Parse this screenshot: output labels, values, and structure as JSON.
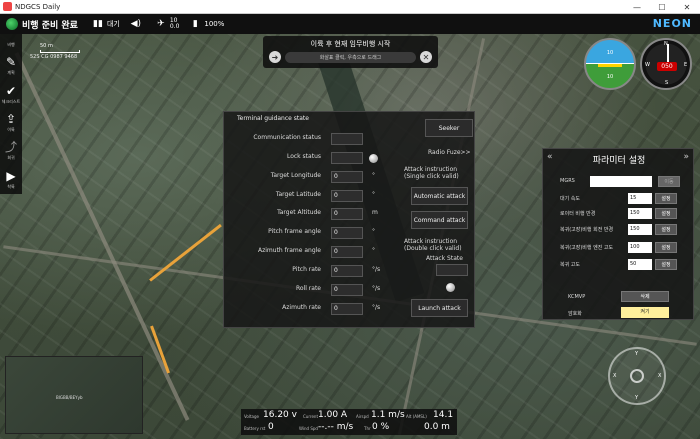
{
  "window": {
    "title": "NDGCS Daily",
    "min": "—",
    "max": "☐",
    "close": "✕"
  },
  "status": {
    "state": "비행 준비 완료",
    "mode_label": "대기",
    "speaker_icon": "speaker-icon",
    "signal_top": "10",
    "signal_bottom": "0.0",
    "battery": "100%"
  },
  "brand": "NEON",
  "toolbar": {
    "items": [
      {
        "label": "비행",
        "icon": "play-icon"
      },
      {
        "label": "계획",
        "icon": "pen-icon"
      },
      {
        "label": "체크리스트",
        "icon": "check-icon"
      },
      {
        "label": "이륙",
        "icon": "takeoff-icon"
      },
      {
        "label": "회귀",
        "icon": "return-icon"
      },
      {
        "label": "착륙",
        "icon": "land-icon"
      }
    ]
  },
  "map": {
    "scale_label": "50 m",
    "coord": "52S CG 0987 9468",
    "minimap_label": "BIGBB/BEYyb"
  },
  "mission": {
    "title": "이륙 후 현재 임무비행 시작",
    "slider_text": "화살표 클릭, 우측으로 드래그",
    "left_icon": "arrow-right-icon",
    "right_icon": "close-icon"
  },
  "attitude": {
    "top": "10",
    "mid": "10"
  },
  "compass": {
    "heading": "050",
    "n": "N",
    "e": "E",
    "s": "S",
    "w": "W"
  },
  "guidance": {
    "title": "Terminal guidance state",
    "rows": [
      {
        "label": "Communication status",
        "value": "",
        "unit": ""
      },
      {
        "label": "Lock status",
        "value": "",
        "unit": ""
      },
      {
        "label": "Target Longitude",
        "value": "0",
        "unit": "°"
      },
      {
        "label": "Target Latitude",
        "value": "0",
        "unit": "°"
      },
      {
        "label": "Target Altitude",
        "value": "0",
        "unit": "m"
      },
      {
        "label": "Pitch frame angle",
        "value": "0",
        "unit": "°"
      },
      {
        "label": "Azimuth frame angle",
        "value": "0",
        "unit": "°"
      },
      {
        "label": "Pitch rate",
        "value": "0",
        "unit": "°/s"
      },
      {
        "label": "Roll rate",
        "value": "0",
        "unit": "°/s"
      },
      {
        "label": "Azimuth rate",
        "value": "0",
        "unit": "°/s"
      }
    ],
    "seeker": "Seeker",
    "radio_fuze": "Radio Fuze>>",
    "attack_instruction_single": "Attack instruction\n(Single click valid)",
    "automatic_attack": "Automatic attack",
    "command_attack": "Command attack",
    "attack_instruction_double": "Attack instruction\n(Double click valid)",
    "attack_state": "Attack State",
    "launch_attack": "Launch attack"
  },
  "params": {
    "title": "파라미터 설정",
    "left": "«",
    "right": "»",
    "mgrs_label": "MGRS",
    "mgrs_btn": "이동",
    "rows": [
      {
        "label": "대기 속도",
        "value": "15",
        "btn": "설정"
      },
      {
        "label": "로이터 비행 반경",
        "value": "150",
        "btn": "설정"
      },
      {
        "label": "복귀(고장)비행 회전 반경",
        "value": "150",
        "btn": "설정"
      },
      {
        "label": "복귀(고장)비행 엔진 고도",
        "value": "100",
        "btn": "설정"
      },
      {
        "label": "복귀 고도",
        "value": "50",
        "btn": "설정"
      }
    ],
    "kcmvp_label": "KCMVP",
    "kcmvp_btn": "삭제",
    "encrypt_label": "암호화",
    "encrypt_btn": "켜기"
  },
  "telemetry": {
    "voltage_label": "Voltage",
    "voltage": "16.20 v",
    "current_label": "Current",
    "current": "1.00 A",
    "airspd_label": "Airspd",
    "airspd": "1.1 m/s",
    "alt_label": "Alt (AMSL)",
    "alt": "14.1",
    "batt_label": "Battery rst",
    "batt": "0",
    "wind_label": "Wind Spd",
    "wind": "--.-- m/s",
    "thr_label": "Thr",
    "thr": "0 %",
    "dist": "0.0 m"
  },
  "joystick": {
    "up": "Y",
    "down": "Y",
    "left": "X",
    "right": "X"
  },
  "colors": {
    "brand": "#4fb9ff",
    "ready": "#4dd26a",
    "encrypt_btn": "#ffef9c",
    "path": "#e8a23a"
  }
}
